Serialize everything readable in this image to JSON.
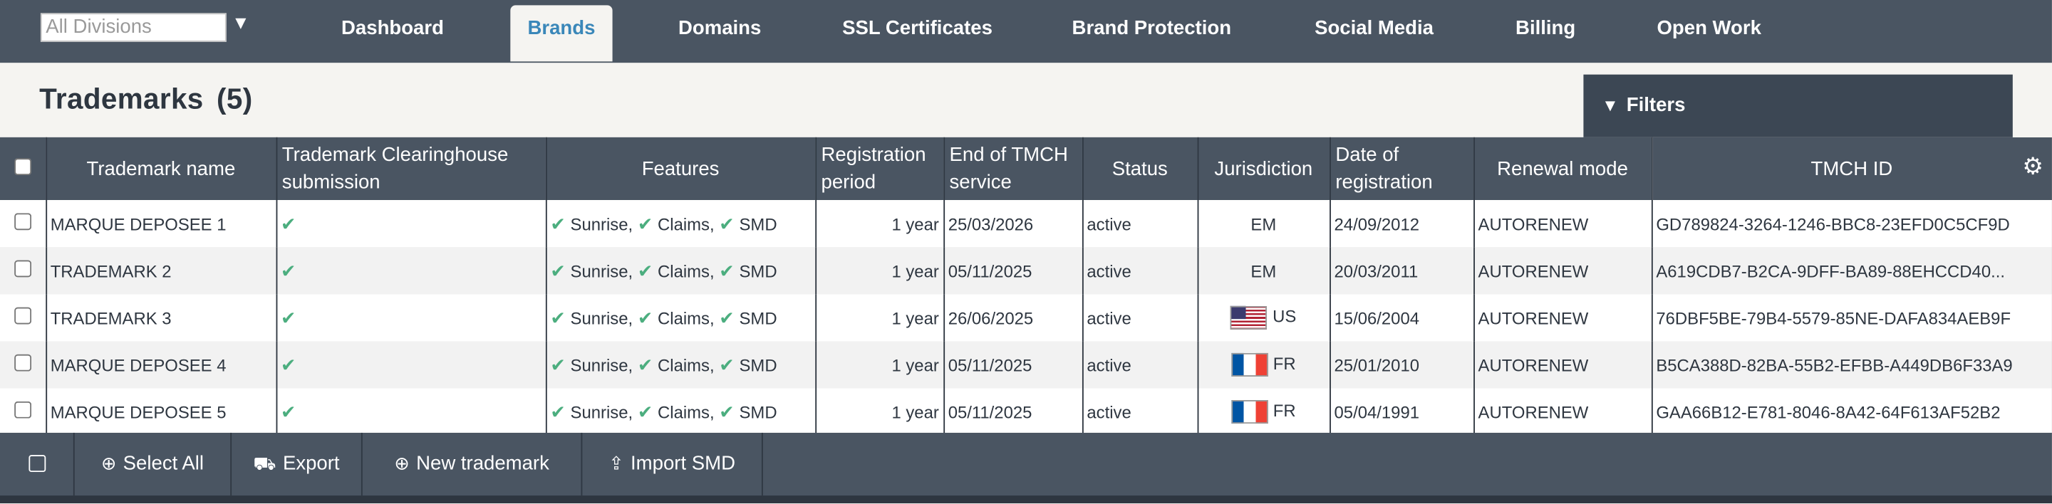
{
  "topnav": {
    "division_value": "All Divisions",
    "tabs": [
      {
        "label": "Dashboard"
      },
      {
        "label": "Brands"
      },
      {
        "label": "Domains"
      },
      {
        "label": "SSL Certificates"
      },
      {
        "label": "Brand Protection"
      },
      {
        "label": "Social Media"
      },
      {
        "label": "Billing"
      },
      {
        "label": "Open Work"
      }
    ],
    "active_tab": "Brands"
  },
  "page": {
    "title": "Trademarks",
    "count": "(5)",
    "filters_label": "Filters"
  },
  "table": {
    "headers": {
      "name": "Trademark name",
      "tmch_submission": "Trademark Clearinghouse submission",
      "features": "Features",
      "reg_period": "Registration period",
      "end_tmch": "End of TMCH service",
      "status": "Status",
      "jurisdiction": "Jurisdiction",
      "date_reg": "Date of registration",
      "renewal": "Renewal mode",
      "tmch_id": "TMCH ID"
    },
    "features_text": {
      "sunrise": "Sunrise,",
      "claims": "Claims,",
      "smd": "SMD"
    },
    "rows": [
      {
        "name": "MARQUE DEPOSEE 1",
        "period": "1 year",
        "end": "25/03/2026",
        "status": "active",
        "jurisdiction": "EM",
        "flag": "",
        "date": "24/09/2012",
        "renewal": "AUTORENEW",
        "tmch_id": "GD789824-3264-1246-BBC8-23EFD0C5CF9D"
      },
      {
        "name": "TRADEMARK 2",
        "period": "1 year",
        "end": "05/11/2025",
        "status": "active",
        "jurisdiction": "EM",
        "flag": "",
        "date": "20/03/2011",
        "renewal": "AUTORENEW",
        "tmch_id": "A619CDB7-B2CA-9DFF-BA89-88EHCCD40..."
      },
      {
        "name": "TRADEMARK 3",
        "period": "1 year",
        "end": "26/06/2025",
        "status": "active",
        "jurisdiction": "US",
        "flag": "us",
        "date": "15/06/2004",
        "renewal": "AUTORENEW",
        "tmch_id": "76DBF5BE-79B4-5579-85NE-DAFA834AEB9F"
      },
      {
        "name": "MARQUE DEPOSEE 4",
        "period": "1 year",
        "end": "05/11/2025",
        "status": "active",
        "jurisdiction": "FR",
        "flag": "fr",
        "date": "25/01/2010",
        "renewal": "AUTORENEW",
        "tmch_id": "B5CA388D-82BA-55B2-EFBB-A449DB6F33A9"
      },
      {
        "name": "MARQUE DEPOSEE 5",
        "period": "1 year",
        "end": "05/11/2025",
        "status": "active",
        "jurisdiction": "FR",
        "flag": "fr",
        "date": "05/04/1991",
        "renewal": "AUTORENEW",
        "tmch_id": "GAA66B12-E781-8046-8A42-64F613AF52B2"
      }
    ]
  },
  "bottombar": {
    "select_all": "Select All",
    "export": "Export",
    "new_trademark": "New trademark",
    "import_smd": "Import SMD"
  },
  "colors": {
    "nav_bg": "#4a5562",
    "active_tab_text": "#3a87b9",
    "check_green": "#4cae7f",
    "filters_bg": "#3c4754"
  },
  "icons": {
    "dropdown": "caret-down-icon",
    "filters": "triangle-down-icon",
    "settings": "gear-icon",
    "select_all": "plus-circle-icon",
    "export": "truck-icon",
    "new": "plus-circle-icon",
    "import": "upload-icon",
    "check": "checkmark-icon"
  }
}
